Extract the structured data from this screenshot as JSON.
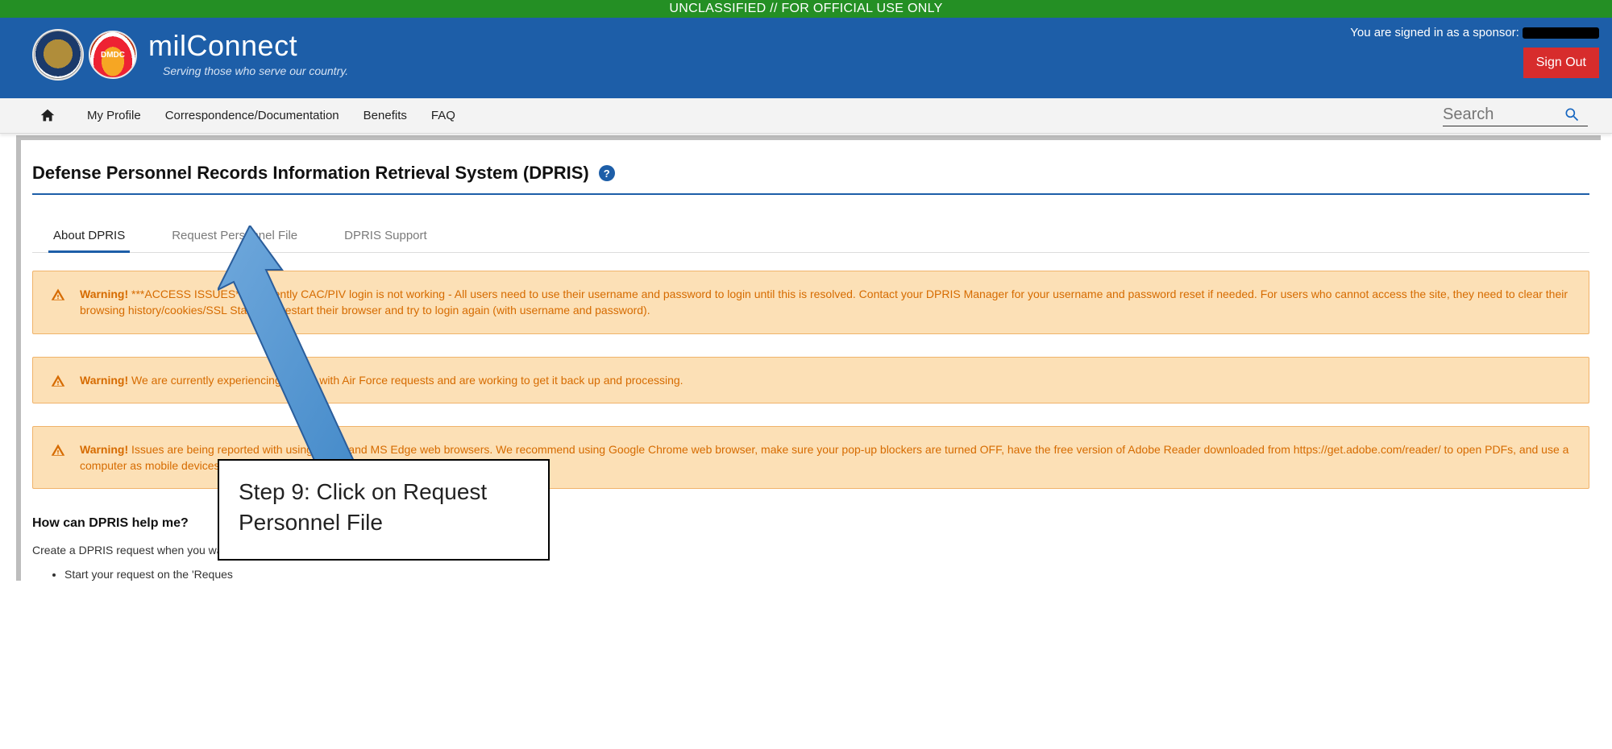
{
  "classification": "UNCLASSIFIED // FOR OFFICIAL USE ONLY",
  "header": {
    "brand_title": "milConnect",
    "brand_sub": "Serving those who serve our country.",
    "signed_in_prefix": "You are signed in as a sponsor:",
    "signout_label": "Sign Out",
    "dmdc_label": "DMDC"
  },
  "nav": {
    "items": [
      "My Profile",
      "Correspondence/Documentation",
      "Benefits",
      "FAQ"
    ],
    "search_placeholder": "Search"
  },
  "page": {
    "title": "Defense Personnel Records Information Retrieval System (DPRIS)",
    "help_glyph": "?"
  },
  "tabs": [
    {
      "label": "About DPRIS",
      "active": true
    },
    {
      "label": "Request Personnel File",
      "active": false
    },
    {
      "label": "DPRIS Support",
      "active": false
    }
  ],
  "alerts": [
    {
      "prefix": "Warning!",
      "text": " ***ACCESS ISSUES*** Currently CAC/PIV login is not working - All users need to use their username and password to login until this is resolved. Contact your DPRIS Manager for your username and password reset if needed. For users who cannot access the site, they need to clear their browsing history/cookies/SSL State and restart their browser and try to login again (with username and password)."
    },
    {
      "prefix": "Warning!",
      "text": " We are currently experiencing issues with Air Force requests and are working to get it back up and processing."
    },
    {
      "prefix": "Warning!",
      "text": " Issues are being reported with using Safari and MS Edge web browsers. We recommend using Google Chrome web browser, make sure your pop-up blockers are turned OFF, have the free version of Adobe Reader downloaded from https://get.adobe.com/reader/ to open PDFs, and use a computer as mobile devices are not currently supported."
    }
  ],
  "how_can": {
    "heading": "How can DPRIS help me?",
    "desc": "Create a DPRIS request when you want",
    "bullet": "Start your request on the 'Reques"
  },
  "annotation": {
    "callout": "Step 9: Click on Request Personnel File"
  }
}
